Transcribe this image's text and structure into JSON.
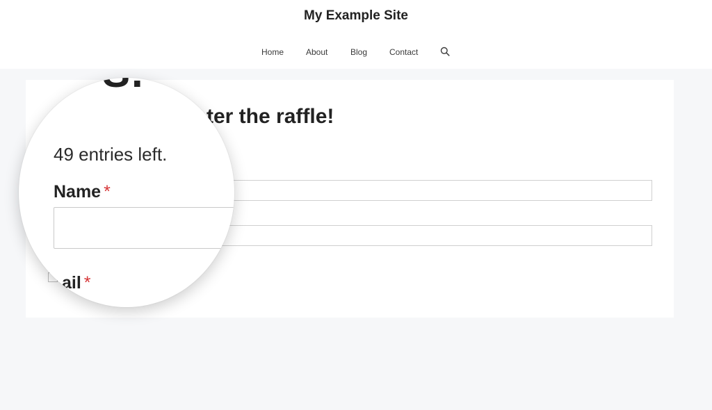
{
  "site": {
    "title": "My Example Site"
  },
  "nav": {
    "items": [
      {
        "label": "Home"
      },
      {
        "label": "About"
      },
      {
        "label": "Blog"
      },
      {
        "label": "Contact"
      }
    ],
    "search_icon": "search-icon"
  },
  "form": {
    "heading": "ter the raffle!",
    "zoom_heading_fragment": "S.",
    "entries_left": "49 entries left.",
    "name_label": "Name",
    "email_label": "ail",
    "required_marker": "*"
  },
  "colors": {
    "page_background": "#f6f7f9",
    "required": "#d63638",
    "border": "#cfcfcf"
  }
}
